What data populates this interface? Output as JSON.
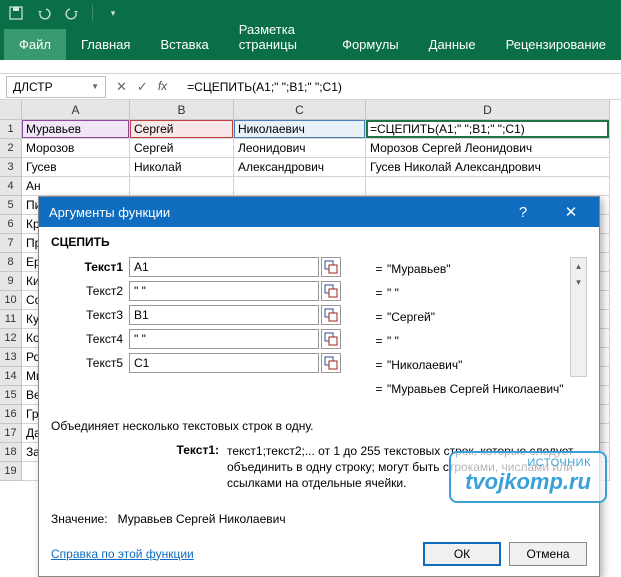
{
  "qat_icons": [
    "save-icon",
    "undo-icon",
    "redo-icon"
  ],
  "ribbon": {
    "tabs": [
      "Файл",
      "Главная",
      "Вставка",
      "Разметка страницы",
      "Формулы",
      "Данные",
      "Рецензирование"
    ],
    "active": 0
  },
  "formula_bar": {
    "name_box": "ДЛСТР",
    "cancel": "✕",
    "confirm": "✓",
    "fx": "fx",
    "formula": "=СЦЕПИТЬ(A1;\" \";B1;\" \";C1)"
  },
  "columns": [
    "A",
    "B",
    "C",
    "D"
  ],
  "rows": [
    {
      "n": "1",
      "A": "Муравьев",
      "B": "Сергей",
      "C": "Николаевич",
      "D": "=СЦЕПИТЬ(A1;\" \";B1;\" \";C1)"
    },
    {
      "n": "2",
      "A": "Морозов",
      "B": "Сергей",
      "C": "Леонидович",
      "D": "Морозов Сергей Леонидович"
    },
    {
      "n": "3",
      "A": "Гусев",
      "B": "Николай",
      "C": "Александрович",
      "D": "Гусев Николай Александрович"
    },
    {
      "n": "4",
      "A": "Ан",
      "B": "",
      "C": "",
      "D": ""
    },
    {
      "n": "5",
      "A": "Пи",
      "B": "",
      "C": "",
      "D": ""
    },
    {
      "n": "6",
      "A": "Кр",
      "B": "",
      "C": "",
      "D": ""
    },
    {
      "n": "7",
      "A": "Пр",
      "B": "",
      "C": "",
      "D": "ч"
    },
    {
      "n": "8",
      "A": "Ер",
      "B": "",
      "C": "",
      "D": ""
    },
    {
      "n": "9",
      "A": "Ки",
      "B": "",
      "C": "",
      "D": ""
    },
    {
      "n": "10",
      "A": "Со",
      "B": "",
      "C": "",
      "D": ""
    },
    {
      "n": "11",
      "A": "Ку",
      "B": "",
      "C": "",
      "D": ""
    },
    {
      "n": "12",
      "A": "Ко",
      "B": "",
      "C": "",
      "D": ""
    },
    {
      "n": "13",
      "A": "Ро",
      "B": "",
      "C": "",
      "D": ""
    },
    {
      "n": "14",
      "A": "Ми",
      "B": "",
      "C": "",
      "D": ""
    },
    {
      "n": "15",
      "A": "Ве",
      "B": "",
      "C": "",
      "D": ""
    },
    {
      "n": "16",
      "A": "Гр",
      "B": "",
      "C": "",
      "D": ""
    },
    {
      "n": "17",
      "A": "Да",
      "B": "",
      "C": "",
      "D": ""
    },
    {
      "n": "18",
      "A": "За",
      "B": "",
      "C": "",
      "D": ""
    },
    {
      "n": "19",
      "A": "",
      "B": "",
      "C": "",
      "D": ""
    }
  ],
  "dialog": {
    "title": "Аргументы функции",
    "help": "?",
    "close": "✕",
    "func": "СЦЕПИТЬ",
    "args": [
      {
        "label": "Текст1",
        "value": "A1",
        "result": "\"Муравьев\"",
        "bold": true
      },
      {
        "label": "Текст2",
        "value": "\" \"",
        "result": "\" \"",
        "bold": false
      },
      {
        "label": "Текст3",
        "value": "B1",
        "result": "\"Сергей\"",
        "bold": false
      },
      {
        "label": "Текст4",
        "value": "\" \"",
        "result": "\" \"",
        "bold": false
      },
      {
        "label": "Текст5",
        "value": "C1",
        "result": "\"Николаевич\"",
        "bold": false
      }
    ],
    "overall_result": "\"Муравьев Сергей Николаевич\"",
    "description": "Объединяет несколько текстовых строк в одну.",
    "arg_desc_label": "Текст1:",
    "arg_desc_text": "текст1;текст2;... от 1 до 255 текстовых строк, которые следует объединить в одну строку; могут быть строками, числами или ссылками на отдельные ячейки.",
    "value_label": "Значение:",
    "value_text": "Муравьев Сергей Николаевич",
    "help_link": "Справка по этой функции",
    "ok": "ОК",
    "cancel": "Отмена"
  },
  "watermark": {
    "line1": "ИСТОЧНИК",
    "line2": "tvojkomp.ru"
  }
}
